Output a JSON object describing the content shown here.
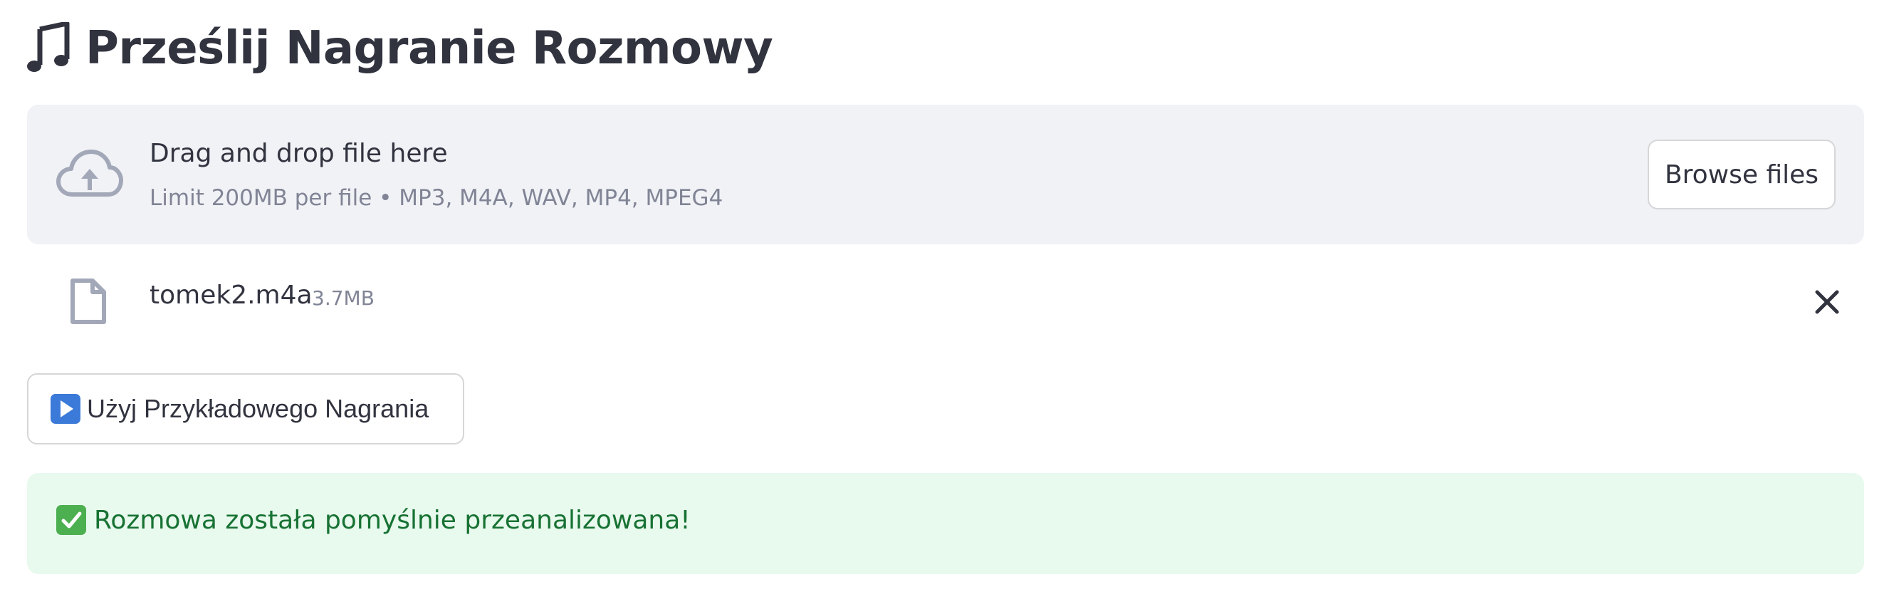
{
  "header": {
    "title": "Prześlij Nagranie Rozmowy",
    "icon": "musical-note-icon"
  },
  "uploader": {
    "drag_text": "Drag and drop file here",
    "limit_text": "Limit 200MB per file • MP3, M4A, WAV, MP4, MPEG4",
    "browse_label": "Browse files",
    "icon": "cloud-upload-icon"
  },
  "uploaded_file": {
    "name": "tomek2.m4a",
    "size": "3.7MB",
    "icon": "file-icon",
    "remove_icon": "close-icon"
  },
  "sample_button": {
    "label": "Użyj Przykładowego Nagrania",
    "icon": "play-button-icon"
  },
  "status": {
    "message": "Rozmowa została pomyślnie przeanalizowana!",
    "icon": "check-mark-icon"
  },
  "colors": {
    "text": "#31333f",
    "muted": "#808495",
    "dropzone_bg": "#f0f2f6",
    "success_bg": "#e8f9ee",
    "success_text": "#177233",
    "play_blue": "#3b7ad9",
    "check_green": "#4caf50"
  }
}
